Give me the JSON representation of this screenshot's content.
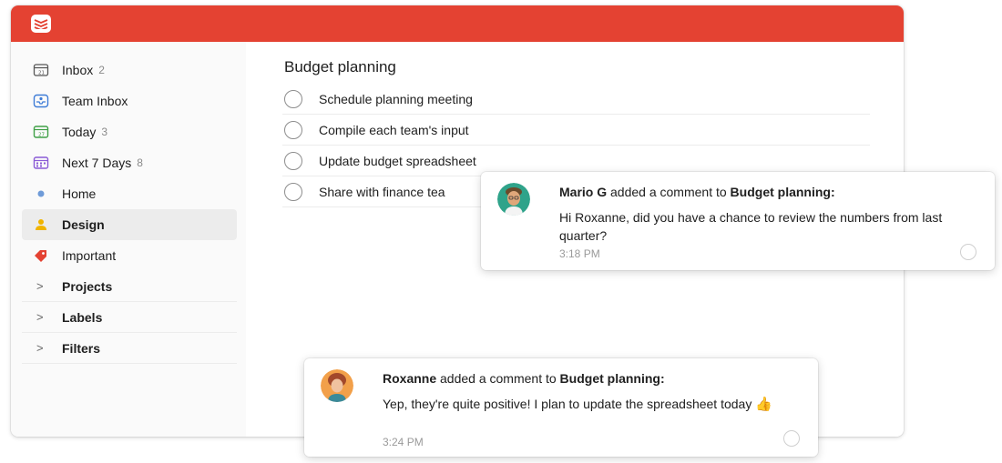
{
  "sidebar": {
    "items": [
      {
        "label": "Inbox",
        "count": "2",
        "icon": "inbox-icon",
        "color": "#555555"
      },
      {
        "label": "Team Inbox",
        "count": "",
        "icon": "team-inbox-icon",
        "color": "#3d7bd6"
      },
      {
        "label": "Today",
        "count": "3",
        "icon": "today-calendar-icon",
        "color": "#3fa046"
      },
      {
        "label": "Next 7 Days",
        "count": "8",
        "icon": "next-7-days-icon",
        "color": "#8a5bd6"
      },
      {
        "label": "Home",
        "count": "",
        "icon": "home-dot-icon",
        "color": "#6f9bd8"
      },
      {
        "label": "Design",
        "count": "",
        "icon": "person-icon",
        "color": "#f0b400"
      },
      {
        "label": "Important",
        "count": "",
        "icon": "label-tag-icon",
        "color": "#e44232"
      }
    ],
    "sections": [
      {
        "label": "Projects"
      },
      {
        "label": "Labels"
      },
      {
        "label": "Filters"
      }
    ]
  },
  "main": {
    "project_title": "Budget planning",
    "tasks": [
      {
        "label": "Schedule planning meeting"
      },
      {
        "label": "Compile each team's input"
      },
      {
        "label": "Update budget spreadsheet"
      },
      {
        "label": "Share with finance tea"
      }
    ]
  },
  "comments": [
    {
      "author": "Mario G",
      "action": "added a comment to",
      "project": "Budget planning:",
      "body": "Hi Roxanne, did you have a chance to review the numbers from last quarter?",
      "time": "3:18 PM"
    },
    {
      "author": "Roxanne",
      "action": "added a comment to",
      "project": "Budget planning:",
      "body": "Yep, they're quite positive! I plan to update the spreadsheet today",
      "emoji": "👍",
      "time": "3:24 PM"
    }
  ],
  "colors": {
    "brand_red": "#e44232",
    "sidebar_bg": "#fafafa",
    "active_item_bg": "#ececec"
  }
}
